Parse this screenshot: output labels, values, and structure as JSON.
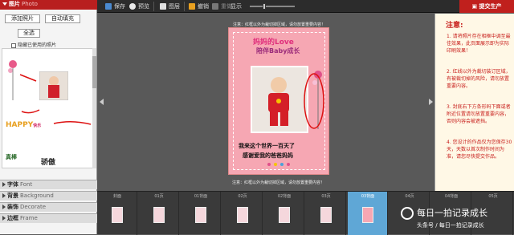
{
  "left_panel": {
    "photo_section": {
      "label": "图片",
      "sublabel": "Photo"
    },
    "buttons": {
      "add_photo": "添加照片",
      "auto_fill": "自动填充",
      "select_all": "全选"
    },
    "hide_used": "隐藏已使用的照片",
    "sections": [
      {
        "label": "字体",
        "sublabel": "Font"
      },
      {
        "label": "背景",
        "sublabel": "Background"
      },
      {
        "label": "装饰",
        "sublabel": "Decorate"
      },
      {
        "label": "边框",
        "sublabel": "Frame"
      }
    ],
    "sticker_texts": {
      "happy": "HAPPY",
      "happy_small": "快乐",
      "jiaoao": "骄傲",
      "zhenjin": "真棒"
    }
  },
  "toolbar": {
    "save": "保存",
    "preview": "预览",
    "layers": "图层",
    "undo": "撤销",
    "redo": "重做",
    "show_label": "显示",
    "zoom_level": 0.3,
    "submit": "提交生产"
  },
  "canvas": {
    "top_note": "注意：红框以外为裁切掉区域，请勿放置重要内容！",
    "bottom_note": "注意：红框以外为裁切掉区域，请勿放置重要内容！",
    "page_title_1": "妈妈的Love",
    "page_title_2": "陪伴Baby成长",
    "caption_line1": "我来这个世界一百天了",
    "caption_line2": "感谢爱我的爸爸妈妈"
  },
  "notice": {
    "title": "注意:",
    "items": [
      "1. 请将照片存在相框中调至最佳效果，此页面展示即为实际印刷效果！",
      "2. 红线以外为裁切装订区域，有被裁切掉的风险，请勿放置重要内容。",
      "3. 封底右下方条形码下面或者附近位置请勿放置重要内容，否则内容会被遮挡。",
      "4. 您设计的作品仅为您保存30天，天数以首次制作时间为准，请您尽快提交作品。"
    ]
  },
  "strip": {
    "pages": [
      "封面",
      "01页",
      "01背面",
      "02页",
      "02背面",
      "03页",
      "03背面",
      "04页",
      "04背面",
      "05页"
    ],
    "selected_index": 6,
    "watermark_line1": "每日一拍记录成长",
    "watermark_line2": "头条号 / 每日一拍记录成长"
  },
  "colors": {
    "brand_red": "#c0201d",
    "page_pink": "#f6a7b3",
    "selected_blue": "#5fa7d6"
  }
}
